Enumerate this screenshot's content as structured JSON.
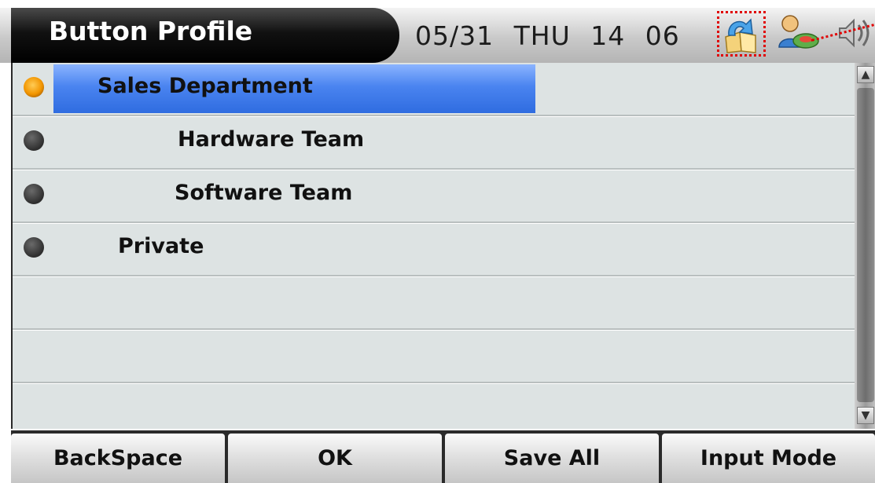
{
  "header": {
    "title": "Button Profile",
    "date": "05/31",
    "weekday": "THU",
    "hour": "14",
    "minute": "06",
    "icons": [
      "phonebook-icon",
      "user-status-icon",
      "sound-icon"
    ]
  },
  "list": {
    "items": [
      {
        "label": "Sales Department",
        "selected": true
      },
      {
        "label": "Hardware Team",
        "selected": false
      },
      {
        "label": "Software Team",
        "selected": false
      },
      {
        "label": "Private",
        "selected": false
      }
    ],
    "empty_rows": 3
  },
  "softkeys": {
    "key1": "BackSpace",
    "key2": "OK",
    "key3": "Save All",
    "key4": "Input Mode"
  },
  "colors": {
    "selection": "#3f7ae8",
    "selected_dot": "#f29500",
    "annotation": "#e00000"
  }
}
